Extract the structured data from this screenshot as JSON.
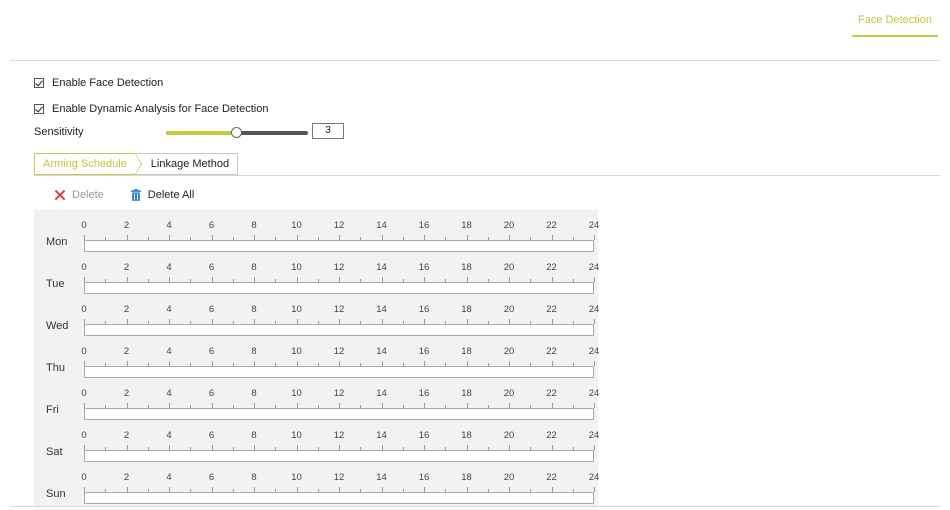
{
  "header": {
    "active_tab": "Face Detection"
  },
  "options": {
    "enable_face_detection": {
      "label": "Enable Face Detection",
      "checked": true
    },
    "enable_dynamic_analysis": {
      "label": "Enable Dynamic Analysis for Face Detection",
      "checked": true
    }
  },
  "sensitivity": {
    "label": "Sensitivity",
    "value": "3",
    "fill_fraction": 0.5
  },
  "tabs": [
    {
      "label": "Arming Schedule",
      "active": true
    },
    {
      "label": "Linkage Method",
      "active": false
    }
  ],
  "toolbar": {
    "delete_label": "Delete",
    "delete_all_label": "Delete All"
  },
  "schedule": {
    "hour_labels": [
      "0",
      "2",
      "4",
      "6",
      "8",
      "10",
      "12",
      "14",
      "16",
      "18",
      "20",
      "22",
      "24"
    ],
    "days": [
      "Mon",
      "Tue",
      "Wed",
      "Thu",
      "Fri",
      "Sat",
      "Sun"
    ]
  },
  "colors": {
    "accent": "#c6ca3c",
    "delete_icon": "#e04040",
    "delete_all_icon": "#2a7fc9"
  },
  "icons": {
    "delete": "x-icon",
    "delete_all": "trash-icon"
  }
}
